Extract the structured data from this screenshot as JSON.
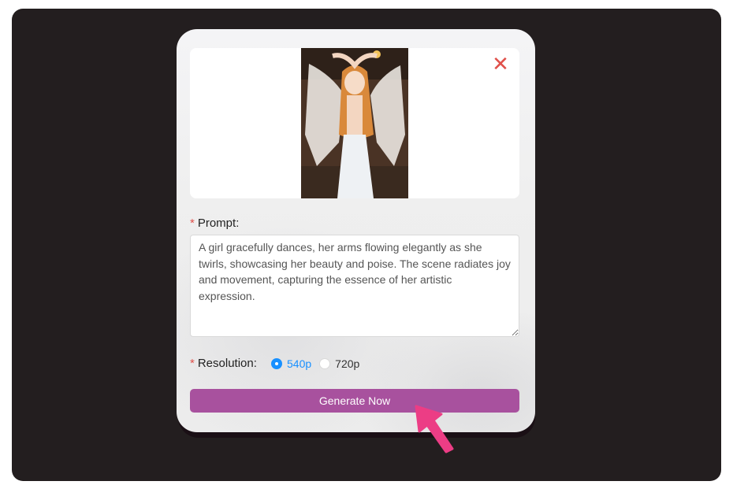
{
  "dialog": {
    "close_glyph": "✕",
    "prompt": {
      "label": "Prompt:",
      "required_mark": "*",
      "value": "A girl gracefully dances, her arms flowing elegantly as she twirls, showcasing her beauty and poise. The scene radiates joy and movement, capturing the essence of her artistic expression."
    },
    "resolution": {
      "label": "Resolution:",
      "required_mark": "*",
      "options": [
        "540p",
        "720p"
      ],
      "selected": "540p"
    },
    "generate_label": "Generate Now"
  },
  "colors": {
    "accent": "#a8519e",
    "radio_active": "#1890ff",
    "required": "#e0504a",
    "cursor": "#ec3d85",
    "backdrop": "#231e1f"
  },
  "icons": {
    "close": "close-icon",
    "pointer": "arrow-pointer-icon"
  }
}
